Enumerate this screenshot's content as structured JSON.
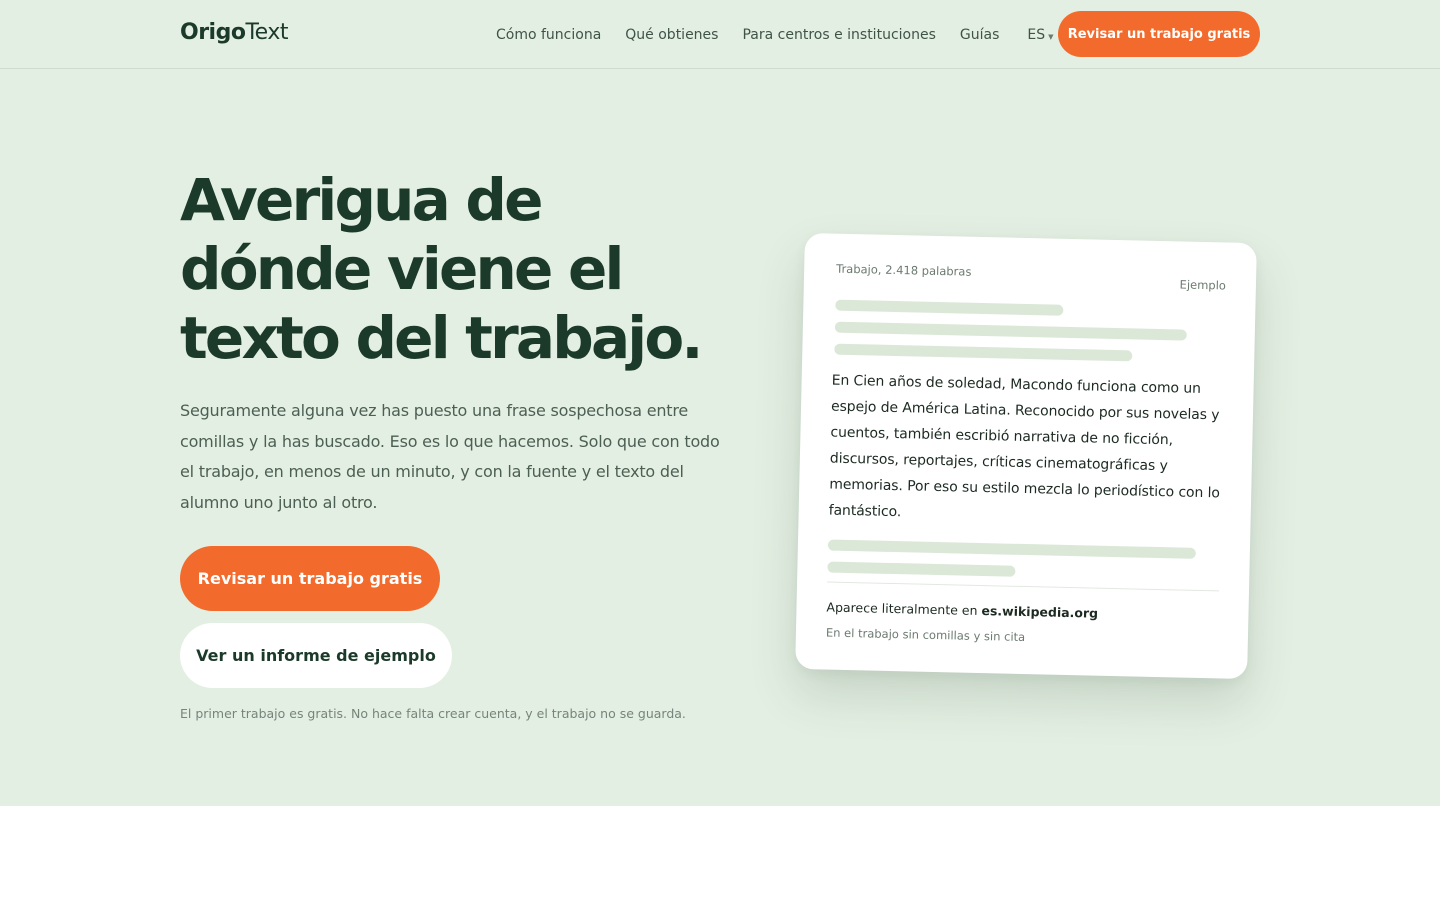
{
  "header": {
    "logo_bold": "Origo",
    "logo_light": "Text",
    "nav": [
      {
        "label": "Cómo funciona"
      },
      {
        "label": "Qué obtienes"
      },
      {
        "label": "Para centros e instituciones"
      },
      {
        "label": "Guías"
      }
    ],
    "lang": "ES",
    "cta": "Revisar un trabajo gratis"
  },
  "hero": {
    "headline": "Averigua de dónde viene el texto del trabajo.",
    "lead": "Seguramente alguna vez has puesto una frase sospechosa entre comillas y la has buscado. Eso es lo que hacemos. Solo que con todo el trabajo, en menos de un minuto, y con la fuente y el texto del alumno uno junto al otro.",
    "primary_cta": "Revisar un trabajo gratis",
    "secondary_cta": "Ver un informe de ejemplo",
    "footnote": "El primer trabajo es gratis. No hace falta crear cuenta, y el trabajo no se guarda."
  },
  "example_card": {
    "meta": "Trabajo, 2.418 palabras",
    "tag": "Ejemplo",
    "quote": "En Cien años de soledad, Macondo funciona como un espejo de América Latina. Reconocido por sus novelas y cuentos, también escribió narrativa de no ficción, discursos, reportajes, críticas cinematográficas y memorias. Por eso su estilo mezcla lo periodístico con lo fantástico.",
    "source_prefix": "Aparece literalmente en",
    "source_domain": "es.wikipedia.org",
    "source_note": "En el trabajo sin comillas y sin cita"
  },
  "colors": {
    "accent": "#f26b2d",
    "hero_bg": "#e4efe3",
    "text_dark": "#1c3a2a",
    "placeholder_bar": "#dbe8d8"
  }
}
